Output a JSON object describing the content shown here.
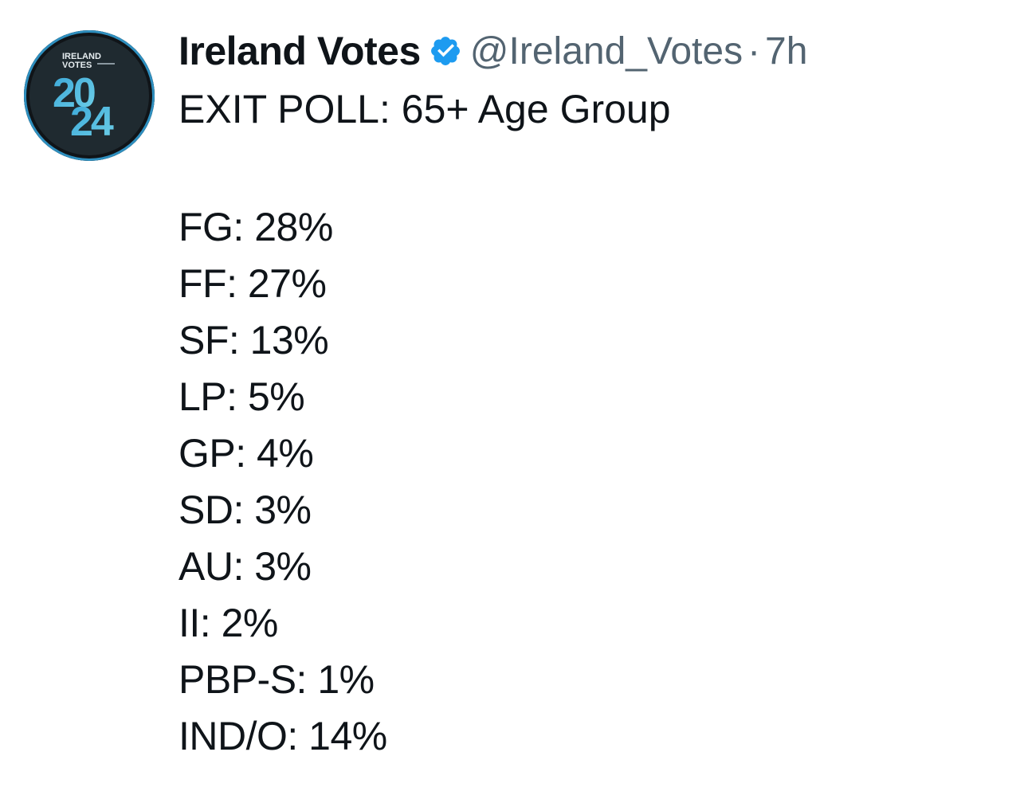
{
  "tweet": {
    "author": {
      "name": "Ireland Votes",
      "handle": "@Ireland_Votes",
      "verified_icon": "verified-badge-icon",
      "avatar": {
        "line1": "IRELAND",
        "line2": "VOTES",
        "year_top": "20",
        "year_bottom": "24"
      }
    },
    "separator": "·",
    "time": "7h",
    "headline": "EXIT POLL: 65+ Age Group",
    "results": [
      "FG: 28%",
      "FF: 27%",
      "SF: 13%",
      "LP: 5%",
      "GP: 4%",
      "SD: 3%",
      "AU: 3%",
      "II: 2%",
      "PBP-S: 1%",
      "IND/O: 14%"
    ]
  },
  "colors": {
    "text": "#0f1419",
    "secondary": "#536471",
    "verified": "#1d9bf0",
    "avatar_bg": "#1f2a30",
    "avatar_ring": "#2e8fbf"
  }
}
